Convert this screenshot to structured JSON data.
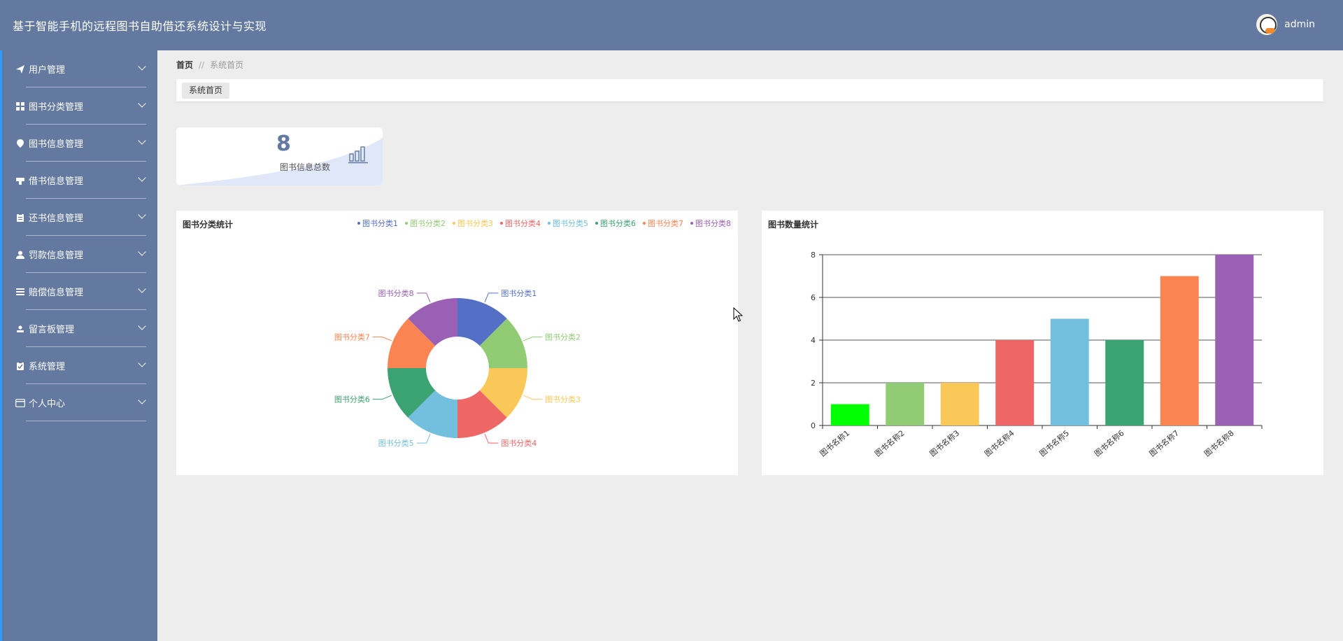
{
  "header": {
    "title": "基于智能手机的远程图书自助借还系统设计与实现",
    "username": "admin"
  },
  "sidebar": {
    "items": [
      {
        "label": "用户管理",
        "icon": "paper-plane-icon"
      },
      {
        "label": "图书分类管理",
        "icon": "grid-icon"
      },
      {
        "label": "图书信息管理",
        "icon": "location-pin-icon"
      },
      {
        "label": "借书信息管理",
        "icon": "stamp-icon"
      },
      {
        "label": "还书信息管理",
        "icon": "clipboard-icon"
      },
      {
        "label": "罚款信息管理",
        "icon": "user-icon"
      },
      {
        "label": "赔偿信息管理",
        "icon": "list-icon"
      },
      {
        "label": "留言板管理",
        "icon": "user-small-icon"
      },
      {
        "label": "系统管理",
        "icon": "clipboard-check-icon"
      },
      {
        "label": "个人中心",
        "icon": "card-icon"
      }
    ]
  },
  "breadcrumb": {
    "home": "首页",
    "separator": "//",
    "current": "系统首页"
  },
  "tabs": [
    {
      "label": "系统首页"
    }
  ],
  "stat_card": {
    "value": "8",
    "label": "图书信息总数"
  },
  "colors": {
    "header_bg": "#63799f",
    "accent": "#2e9bff"
  },
  "chart_data": [
    {
      "type": "pie",
      "title": "图书分类统计",
      "donut": true,
      "legend_position": "top-right",
      "categories": [
        "图书分类1",
        "图书分类2",
        "图书分类3",
        "图书分类4",
        "图书分类5",
        "图书分类6",
        "图书分类7",
        "图书分类8"
      ],
      "values": [
        1,
        1,
        1,
        1,
        1,
        1,
        1,
        1
      ],
      "colors": [
        "#5470c6",
        "#91cc75",
        "#fac858",
        "#ee6666",
        "#73c0de",
        "#3ba272",
        "#fc8452",
        "#9a60b4"
      ]
    },
    {
      "type": "bar",
      "title": "图书数量统计",
      "categories": [
        "图书名称1",
        "图书名称2",
        "图书名称3",
        "图书名称4",
        "图书名称5",
        "图书名称6",
        "图书名称7",
        "图书名称8"
      ],
      "values": [
        1,
        2,
        2,
        4,
        5,
        4,
        7,
        8
      ],
      "colors": [
        "#00ff00",
        "#91cc75",
        "#fac858",
        "#ee6666",
        "#73c0de",
        "#3ba272",
        "#fc8452",
        "#9a60b4"
      ],
      "ylim": [
        0,
        8
      ],
      "yticks": [
        0,
        2,
        4,
        6,
        8
      ],
      "grid": true
    }
  ]
}
